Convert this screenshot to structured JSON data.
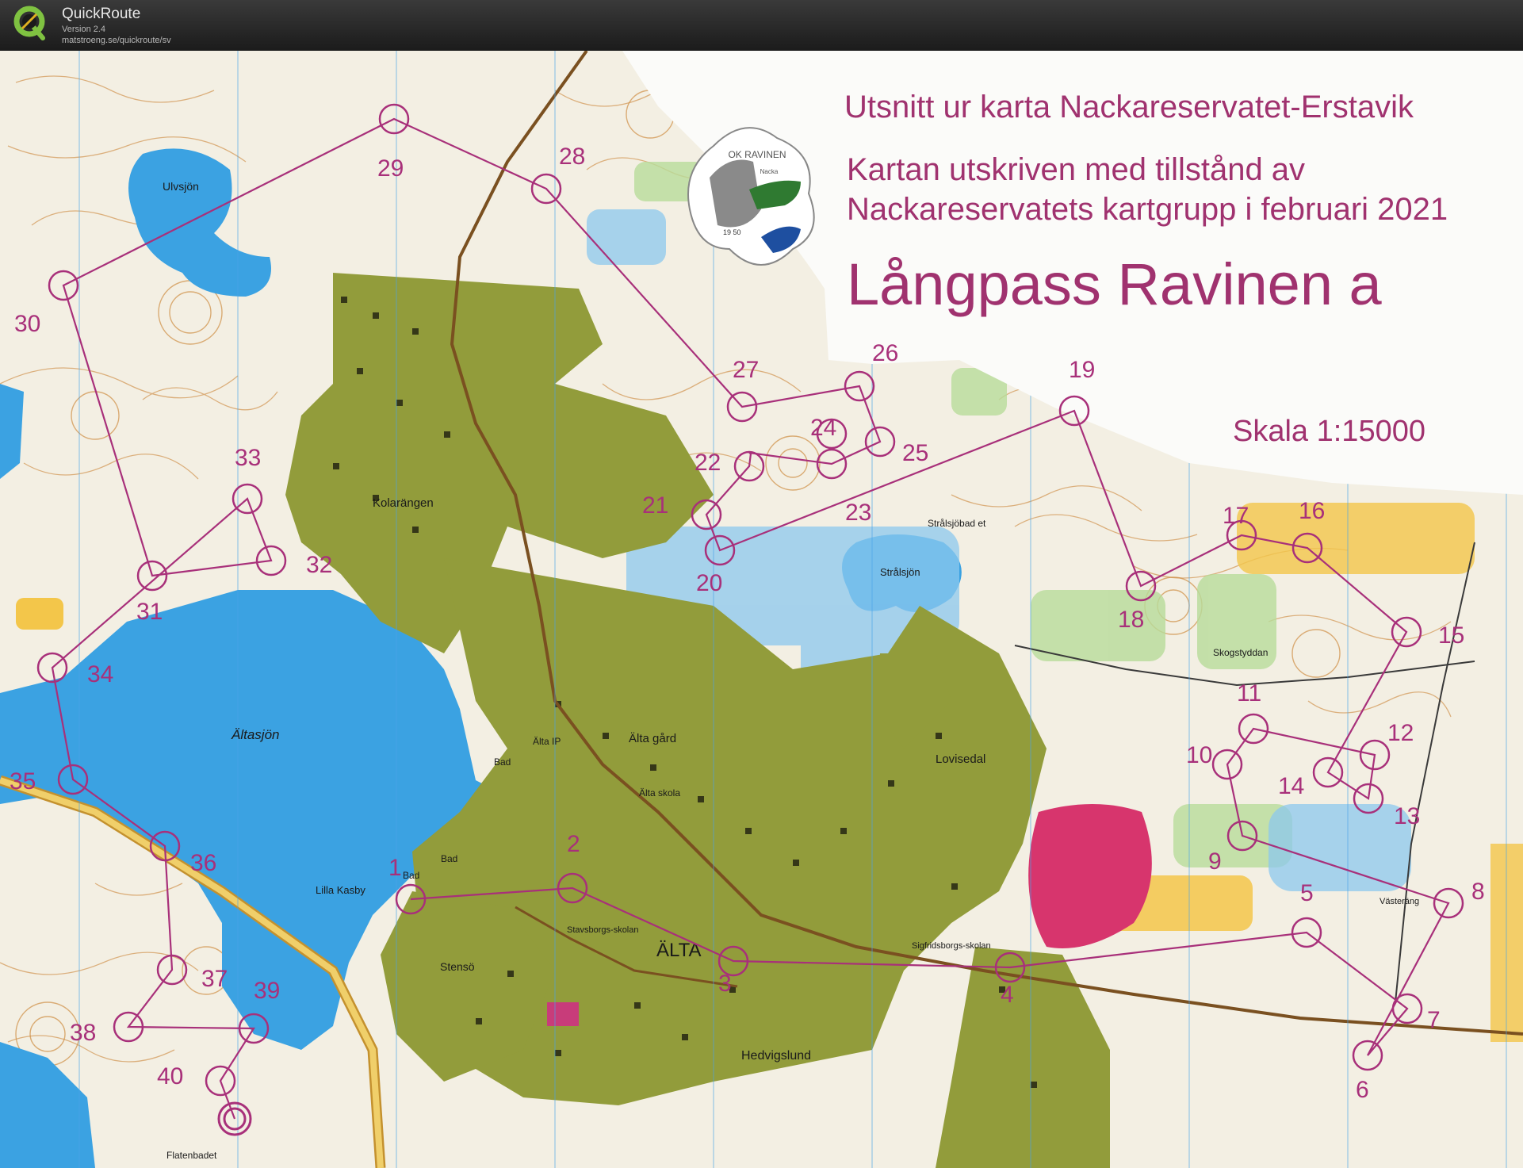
{
  "app": {
    "title": "QuickRoute",
    "version": "Version 2.4",
    "url": "matstroeng.se/quickroute/sv"
  },
  "map": {
    "header_line1": "Utsnitt ur karta Nackareservatet-Erstavik",
    "header_line2": "Kartan utskriven med tillstånd av",
    "header_line3": "Nackareservatets kartgrupp i februari 2021",
    "course_title": "Långpass Ravinen a",
    "scale": "Skala 1:15000",
    "club_logo_text": "OK RAVINEN",
    "club_logo_sub": "Nacka",
    "club_logo_year": "19 50",
    "place_names": {
      "ulvsjon": "Ulvsjön",
      "kolarangen": "Kolarängen",
      "altasjon": "Ältasjön",
      "lilla_kasby": "Lilla Kasby",
      "alta": "ÄLTA",
      "alta_gard": "Älta gård",
      "alta_ip": "Älta IP",
      "alta_skola": "Älta skola",
      "bad1": "Bad",
      "bad2": "Bad",
      "bad3": "Bad",
      "stensö": "Stensö",
      "stavsborgsskolan": "Stavsborgs-skolan",
      "hedvigslund": "Hedvigslund",
      "lovisedal": "Lovisedal",
      "stralsjon": "Strålsjön",
      "stralsjobadet": "Strålsjöbad et",
      "skogstyddan": "Skogstyddan",
      "vasterang": "Västeräng",
      "flatenbadet": "Flatenbadet",
      "sigtunaskolan": "Sigfridsborgs-skolan"
    },
    "controls": [
      {
        "n": "1",
        "label": "1"
      },
      {
        "n": "2",
        "label": "2"
      },
      {
        "n": "3",
        "label": "3"
      },
      {
        "n": "4",
        "label": "4"
      },
      {
        "n": "5",
        "label": "5"
      },
      {
        "n": "6",
        "label": "6"
      },
      {
        "n": "7",
        "label": "7"
      },
      {
        "n": "8",
        "label": "8"
      },
      {
        "n": "9",
        "label": "9"
      },
      {
        "n": "10",
        "label": "10"
      },
      {
        "n": "11",
        "label": "11"
      },
      {
        "n": "12",
        "label": "12"
      },
      {
        "n": "13",
        "label": "13"
      },
      {
        "n": "14",
        "label": "14"
      },
      {
        "n": "15",
        "label": "15"
      },
      {
        "n": "16",
        "label": "16"
      },
      {
        "n": "17",
        "label": "17"
      },
      {
        "n": "18",
        "label": "18"
      },
      {
        "n": "19",
        "label": "19"
      },
      {
        "n": "20",
        "label": "20"
      },
      {
        "n": "21",
        "label": "21"
      },
      {
        "n": "22",
        "label": "22"
      },
      {
        "n": "23",
        "label": "23"
      },
      {
        "n": "24",
        "label": "24"
      },
      {
        "n": "25",
        "label": "25"
      },
      {
        "n": "26",
        "label": "26"
      },
      {
        "n": "27",
        "label": "27"
      },
      {
        "n": "28",
        "label": "28"
      },
      {
        "n": "29",
        "label": "29"
      },
      {
        "n": "30",
        "label": "30"
      },
      {
        "n": "31",
        "label": "31"
      },
      {
        "n": "32",
        "label": "32"
      },
      {
        "n": "33",
        "label": "33"
      },
      {
        "n": "34",
        "label": "34"
      },
      {
        "n": "35",
        "label": "35"
      },
      {
        "n": "36",
        "label": "36"
      },
      {
        "n": "37",
        "label": "37"
      },
      {
        "n": "38",
        "label": "38"
      },
      {
        "n": "39",
        "label": "39"
      },
      {
        "n": "40",
        "label": "40"
      }
    ],
    "colors": {
      "course": "#a8307a",
      "water": "#3aa0e0",
      "settlement": "#8f9a3a",
      "open_land": "#f2c94c",
      "forest": "#f4f0e4",
      "contour": "#c8853a"
    }
  }
}
